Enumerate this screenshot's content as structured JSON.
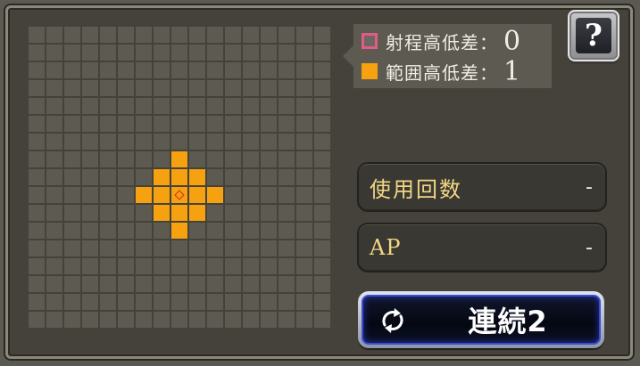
{
  "range_grid": {
    "size": 17,
    "highlighted_cells": [
      [
        7,
        8
      ],
      [
        8,
        7
      ],
      [
        8,
        8
      ],
      [
        8,
        9
      ],
      [
        9,
        6
      ],
      [
        9,
        7
      ],
      [
        9,
        9
      ],
      [
        9,
        10
      ],
      [
        10,
        7
      ],
      [
        10,
        8
      ],
      [
        10,
        9
      ],
      [
        11,
        8
      ]
    ],
    "center_cell": [
      9,
      8
    ],
    "highlight_color": "#f6a10f",
    "center_marker_color": "#d8252a"
  },
  "legend": {
    "range_height_label": "射程高低差：",
    "range_height_value": "0",
    "area_height_label": "範囲高低差：",
    "area_height_value": "1",
    "range_color": "#e25a86",
    "area_color": "#f6a10f"
  },
  "help_button": {
    "label": "?"
  },
  "stats": {
    "uses_label": "使用回数",
    "uses_value": "-",
    "ap_label": "AP",
    "ap_value": "-"
  },
  "chain_button": {
    "label": "連続2",
    "icon": "cycle-arrows-icon"
  }
}
